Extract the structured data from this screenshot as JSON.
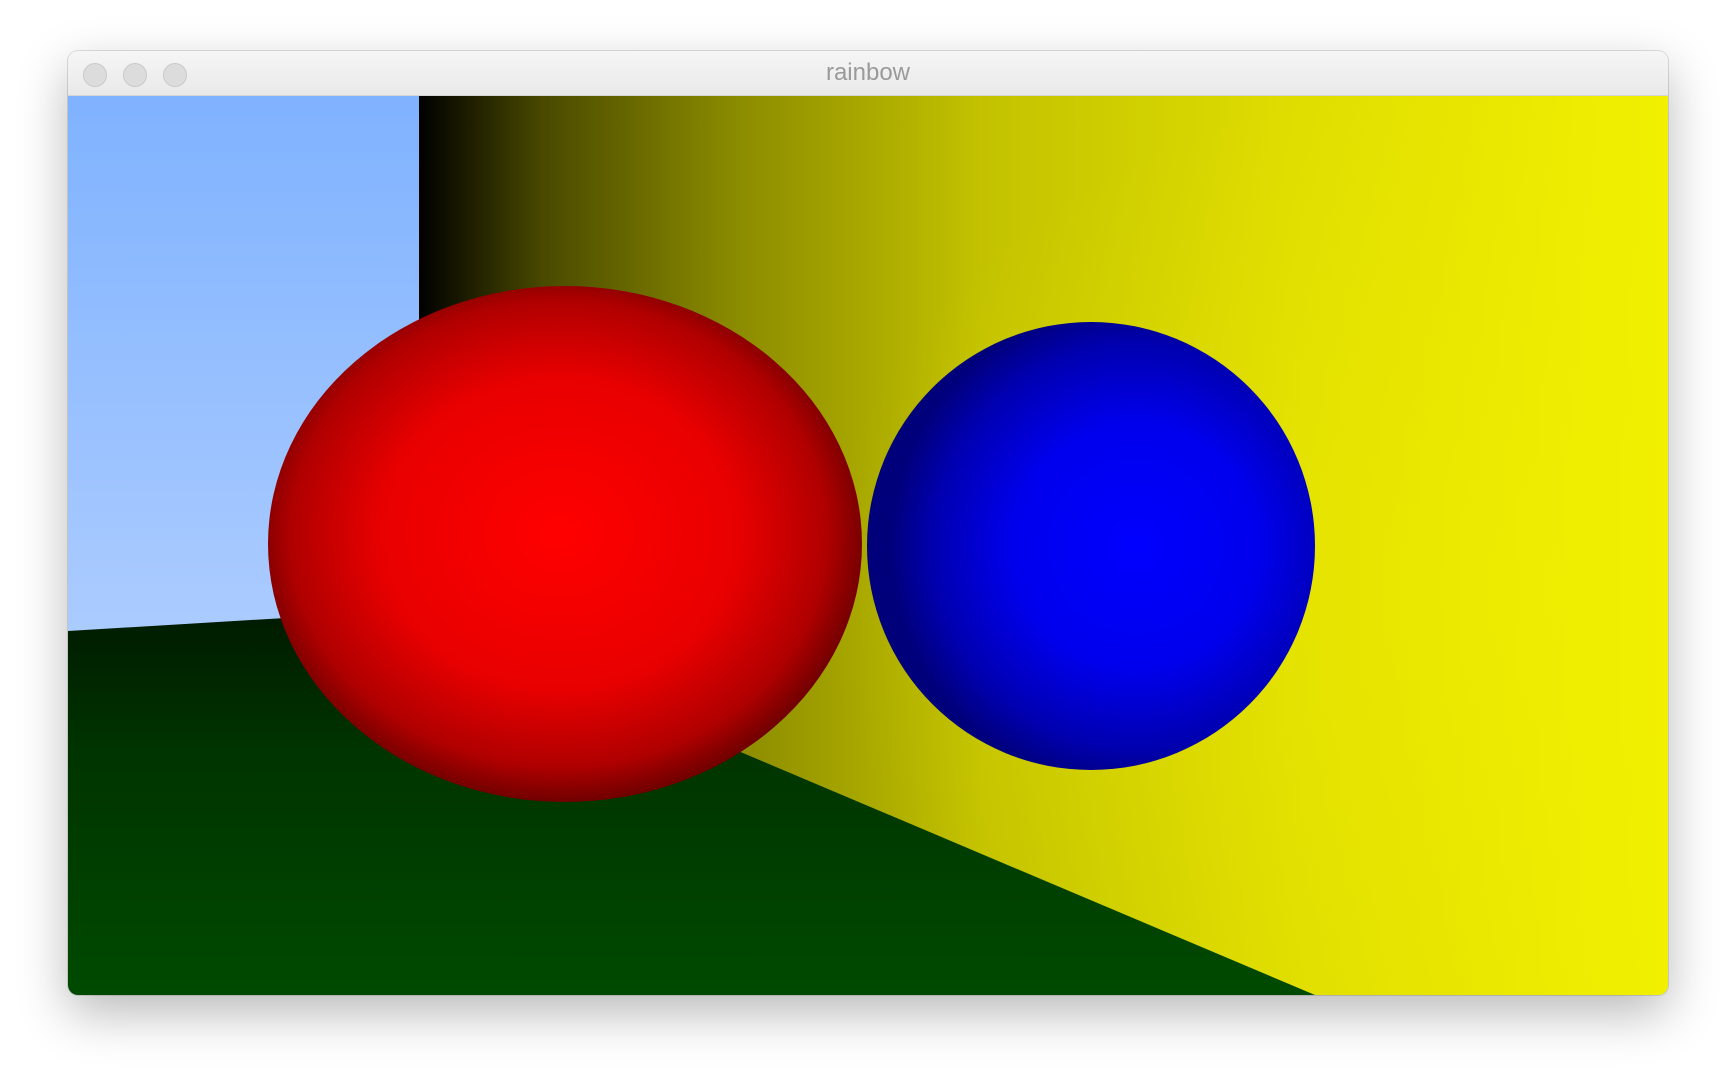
{
  "window": {
    "title": "rainbow"
  },
  "titlebar": {
    "buttons": [
      {
        "name": "close",
        "color": "#dcdcdc"
      },
      {
        "name": "minimize",
        "color": "#dcdcdc"
      },
      {
        "name": "zoom",
        "color": "#dcdcdc"
      }
    ]
  },
  "scene": {
    "sky_top_color": "#7fb2ff",
    "sky_bottom_color": "#c9ddff",
    "wall_dark_color": "#000000",
    "wall_bright_color": "#f2f000",
    "floor_dark_color": "#001a00",
    "floor_bright_color": "#004a00",
    "red_sphere_color": "#ff0000",
    "blue_sphere_color": "#0000ff"
  }
}
